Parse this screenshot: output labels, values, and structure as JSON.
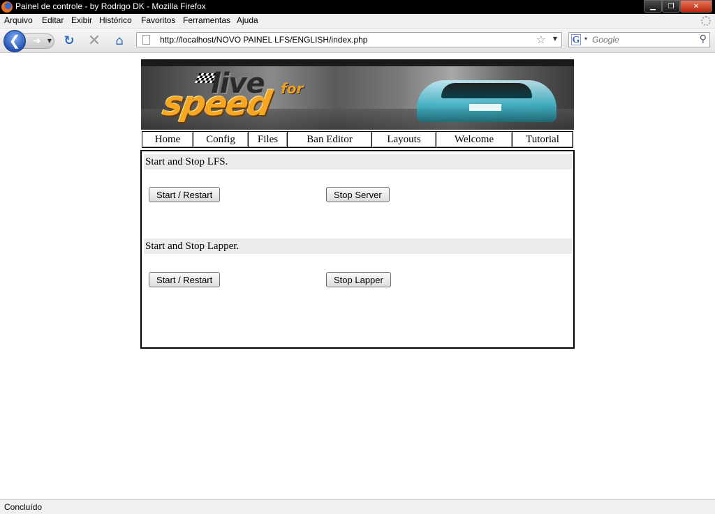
{
  "window": {
    "title": "Painel de controle - by Rodrigo DK - Mozilla Firefox"
  },
  "menu": {
    "items": [
      "Arquivo",
      "Editar",
      "Exibir",
      "Histórico",
      "Favoritos",
      "Ferramentas",
      "Ajuda"
    ]
  },
  "toolbar": {
    "url": "http://localhost/NOVO PAINEL LFS/ENGLISH/index.php",
    "search_placeholder": "Google"
  },
  "nav": {
    "items": [
      "Home",
      "Config",
      "Files",
      "Ban Editor",
      "Layouts",
      "Welcome",
      "Tutorial"
    ]
  },
  "sections": [
    {
      "heading": "Start and Stop LFS.",
      "start_label": "Start / Restart",
      "stop_label": "Stop Server"
    },
    {
      "heading": "Start and Stop Lapper.",
      "start_label": "Start / Restart",
      "stop_label": "Stop Lapper"
    }
  ],
  "banner": {
    "logo_live": "live",
    "logo_for": "for",
    "logo_speed": "speed"
  },
  "status": {
    "text": "Concluído"
  }
}
